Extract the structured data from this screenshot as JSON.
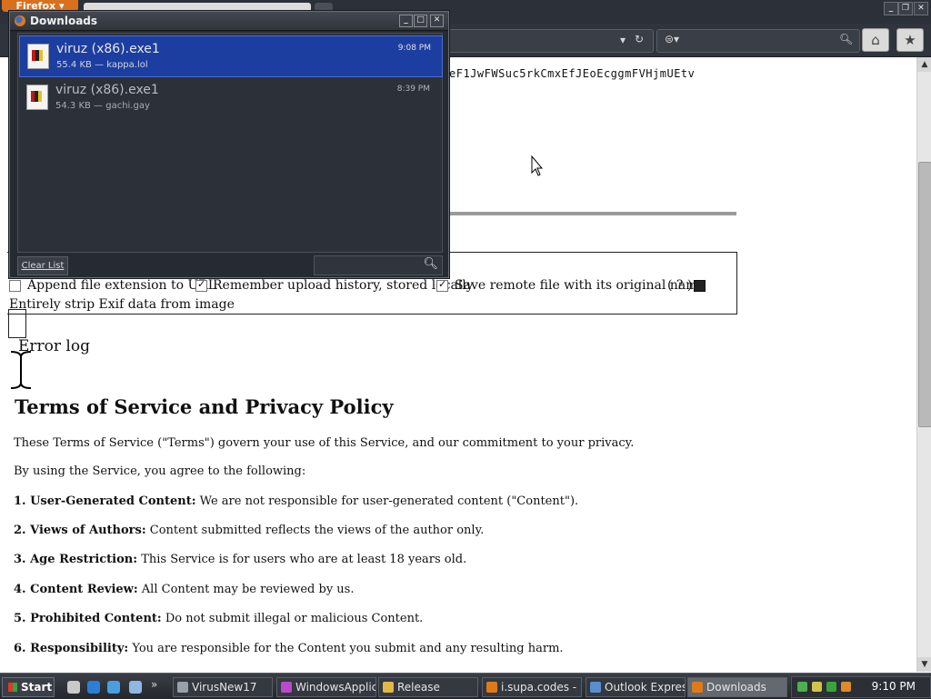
{
  "browser": {
    "menu_button": "Firefox ▾",
    "window_controls": [
      "_",
      "❐",
      "✕"
    ],
    "home_icon": "home-icon",
    "bookmark_icon": "bookmark-star-icon"
  },
  "page": {
    "hash_text": "eF1JwFWSuc5rkCmxEfJEoEcggmFVHjmUEtv",
    "options": {
      "append_ext": "Append file extension to URL",
      "remember_history": "Remember upload history, stored locally",
      "save_remote": "Save remote file with its original name",
      "help": "( ? )",
      "strip_exif": "Entirely strip Exif data from image"
    },
    "error_log": "Error log",
    "tos": {
      "title": "Terms of Service and Privacy Policy",
      "intro": "These Terms of Service (\"Terms\") govern your use of this Service, and our commitment to your privacy.",
      "agree": "By using the Service, you agree to the following:",
      "items": [
        {
          "label": "1. User-Generated Content:",
          "text": "We are not responsible for user-generated content (\"Content\")."
        },
        {
          "label": "2. Views of Authors:",
          "text": "Content submitted reflects the views of the author only."
        },
        {
          "label": "3. Age Restriction:",
          "text": "This Service is for users who are at least 18 years old."
        },
        {
          "label": "4. Content Review:",
          "text": "All Content may be reviewed by us."
        },
        {
          "label": "5. Prohibited Content:",
          "text": "Do not submit illegal or malicious Content."
        },
        {
          "label": "6. Responsibility:",
          "text": "You are responsible for the Content you submit and any resulting harm."
        }
      ]
    }
  },
  "downloads": {
    "title": "Downloads",
    "items": [
      {
        "name": "viruz (x86).exe1",
        "meta": "55.4 KB — kappa.lol",
        "time": "9:08 PM"
      },
      {
        "name": "viruz (x86).exe1",
        "meta": "54.3 KB — gachi.gay",
        "time": "8:39 PM"
      }
    ],
    "clear_list": "Clear List"
  },
  "taskbar": {
    "start": "Start",
    "tasks": [
      "VirusNew17",
      "WindowsApplic...",
      "Release",
      "i.supa.codes - ...",
      "Outlook Express",
      "Downloads"
    ],
    "clock": "9:10 PM",
    "overflow": "»"
  },
  "colors": {
    "selection": "#1c3ea0",
    "firefox_orange": "#d9701e"
  }
}
